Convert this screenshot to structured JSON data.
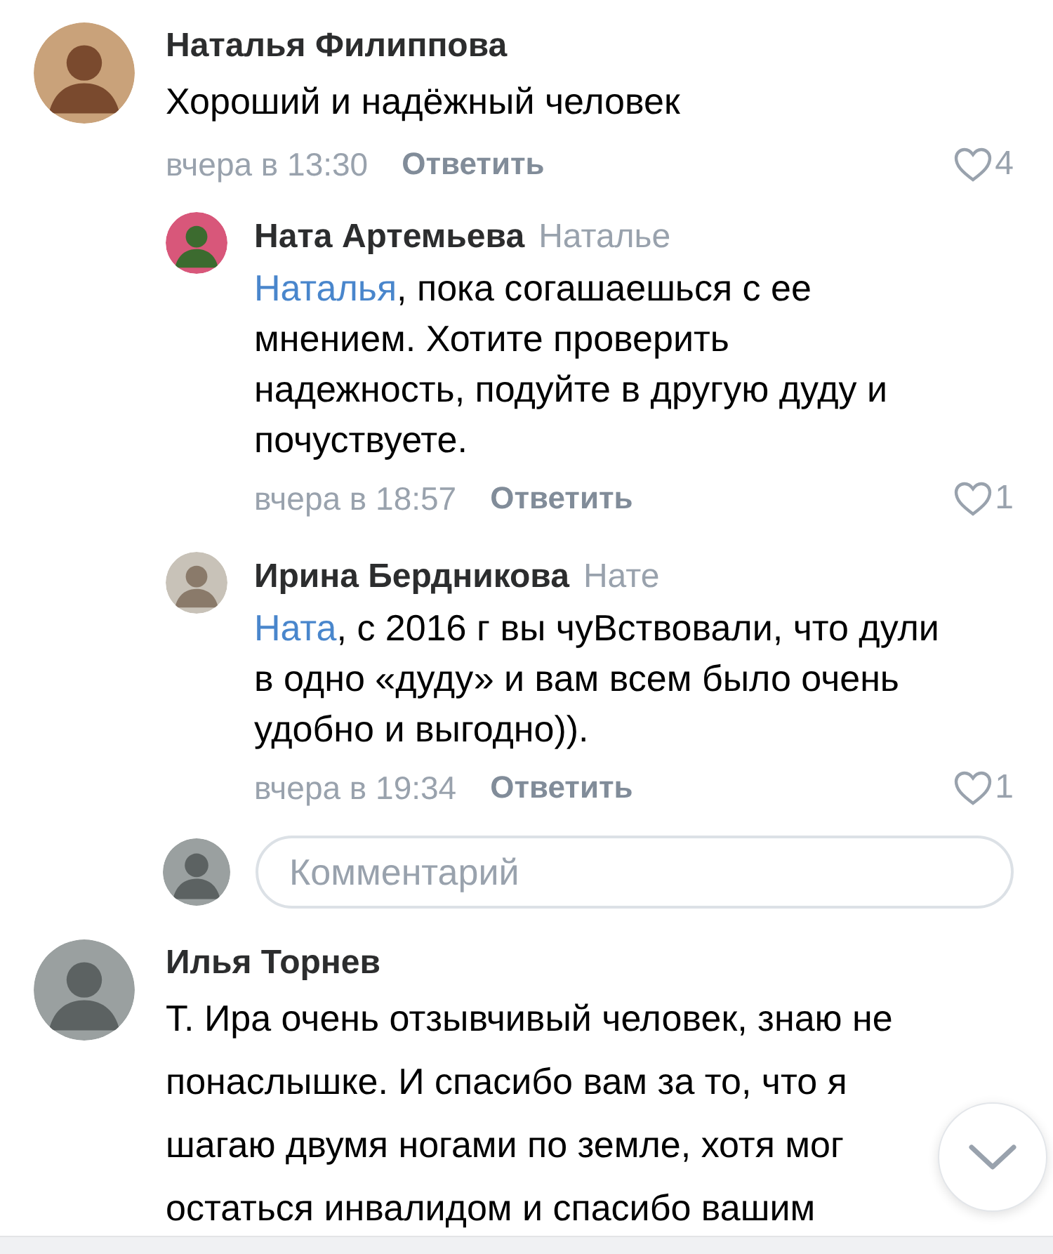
{
  "comments": [
    {
      "author": "Наталья Филиппова",
      "text": "Хороший и надёжный человек",
      "time": "вчера в 13:30",
      "reply_label": "Ответить",
      "likes": "4",
      "replies": [
        {
          "author": "Ната Артемьева",
          "reply_to": "Наталье",
          "mention": "Наталья",
          "text": ", пока согашаешься с ее мнением. Хотите проверить надежность, подуйте в другую дуду и почуствуете.",
          "time": "вчера в 18:57",
          "reply_label": "Ответить",
          "likes": "1"
        },
        {
          "author": "Ирина Бердникова",
          "reply_to": "Нате",
          "mention": "Ната",
          "text": ", с 2016 г вы чуВствовали, что дули в одно «дуду» и вам всем было очень удобно и выгодно)).",
          "time": "вчера в 19:34",
          "reply_label": "Ответить",
          "likes": "1"
        }
      ],
      "composer": {
        "placeholder": "Комментарий"
      }
    },
    {
      "author": "Илья Торнев",
      "text": "Т. Ира очень отзывчивый человек, знаю не понаслышке. И спасибо вам за то, что я шагаю двумя ногами по земле, хотя мог остаться инвалидом и спасибо вашим"
    }
  ]
}
